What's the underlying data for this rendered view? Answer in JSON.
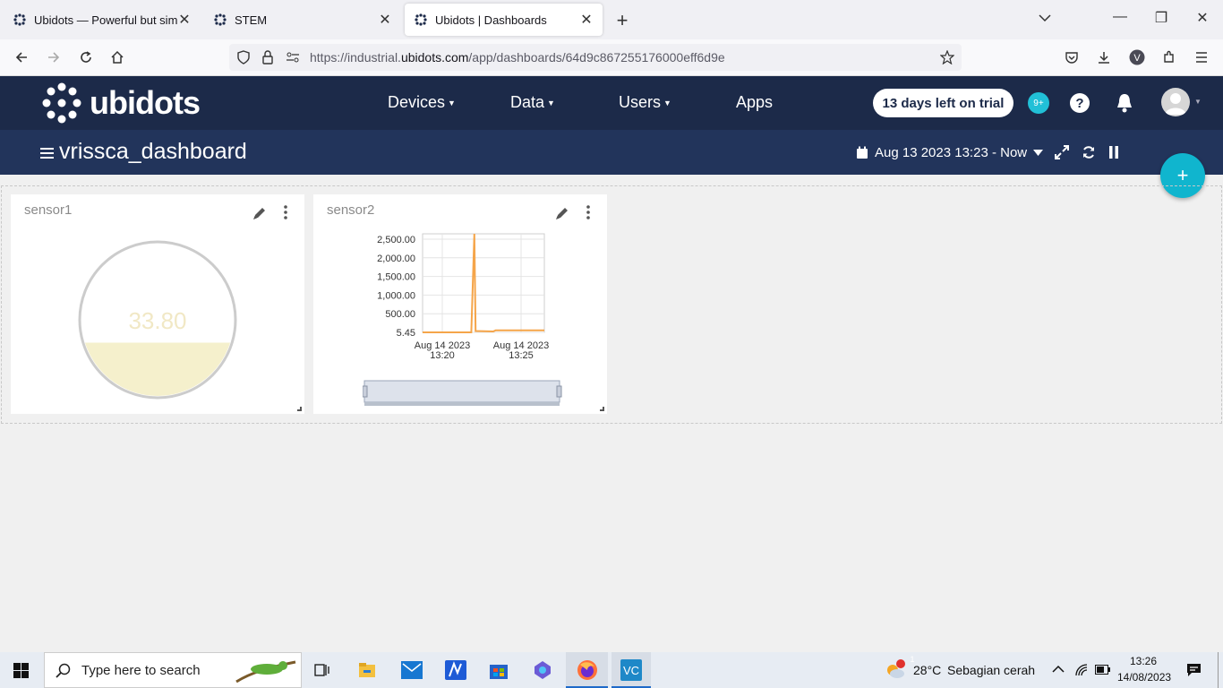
{
  "browser": {
    "tabs": [
      {
        "title": "Ubidots — Powerful but simple"
      },
      {
        "title": "STEM"
      },
      {
        "title": "Ubidots | Dashboards"
      }
    ],
    "url_prefix": "https://industrial.",
    "url_domain": "ubidots.com",
    "url_path": "/app/dashboards/64d9c867255176000eff6d9e"
  },
  "header": {
    "logo": "ubidots",
    "menu": [
      "Devices",
      "Data",
      "Users",
      "Apps"
    ],
    "trial": "13 days left on trial",
    "notif_badge": "9+",
    "help": "?"
  },
  "dashboard": {
    "title": "vrissca_dashboard",
    "date_range": "Aug 13 2023 13:23 - Now"
  },
  "widgets": {
    "sensor1": {
      "title": "sensor1",
      "value": "33.80",
      "fill_fraction": 0.35
    },
    "sensor2": {
      "title": "sensor2"
    }
  },
  "chart_data": {
    "type": "line",
    "y_ticks": [
      "2,500.00",
      "2,000.00",
      "1,500.00",
      "1,000.00",
      "500.00",
      "5.45"
    ],
    "x_ticks": [
      {
        "date": "Aug 14 2023",
        "time": "13:20"
      },
      {
        "date": "Aug 14 2023",
        "time": "13:25"
      }
    ],
    "ylim": [
      5.45,
      2600
    ],
    "series": [
      {
        "color": "#f5a54a",
        "points": [
          [
            0,
            5.45
          ],
          [
            0.4,
            5.45
          ],
          [
            0.425,
            2600
          ],
          [
            0.435,
            40
          ],
          [
            0.58,
            30
          ],
          [
            0.6,
            60
          ],
          [
            1.0,
            60
          ]
        ]
      }
    ]
  },
  "taskbar": {
    "search_placeholder": "Type here to search",
    "weather_temp": "28°C",
    "weather_desc": "Sebagian cerah",
    "weather_badge": "1",
    "time": "13:26",
    "date": "14/08/2023"
  },
  "colors": {
    "header_bg": "#1c2a49",
    "dashbar_bg": "#22345b",
    "accent": "#10b5ce",
    "gauge_fill": "#f5f0cc"
  }
}
